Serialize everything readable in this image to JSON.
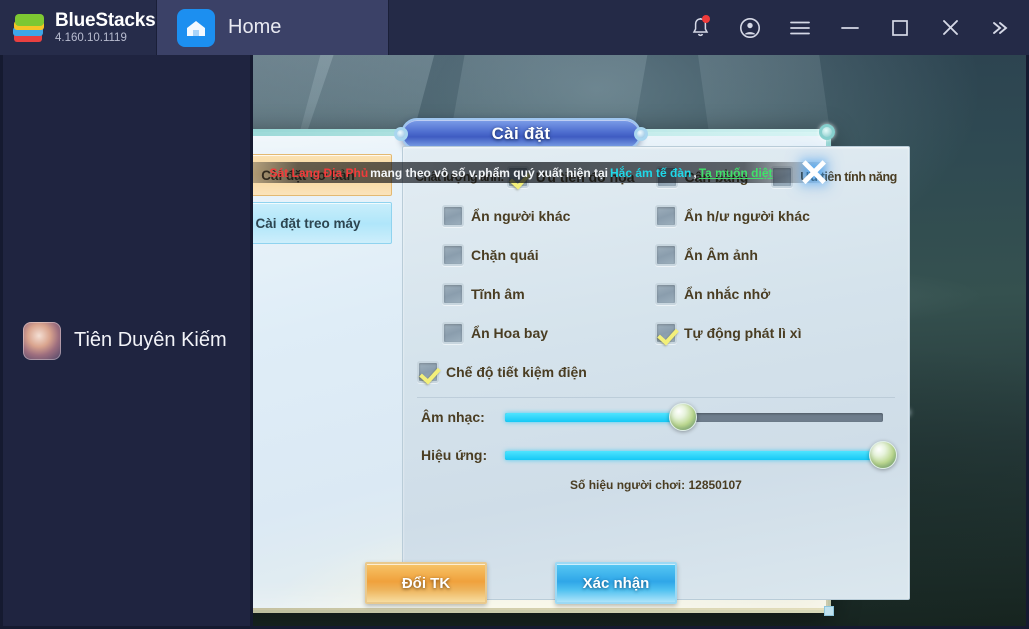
{
  "bluestacks": {
    "brand": "BlueStacks",
    "version": "4.160.10.1119",
    "tabs": [
      {
        "label": "Home",
        "icon": "home-icon"
      },
      {
        "label": "Tiên Duyên Kiếm",
        "icon": "game-avatar"
      }
    ],
    "controls": [
      {
        "name": "notifications-bell",
        "glyph": "🔔",
        "badge": true
      },
      {
        "name": "account",
        "glyph": "ⓘ"
      },
      {
        "name": "menu",
        "glyph": "☰"
      },
      {
        "name": "minimize",
        "glyph": "–"
      },
      {
        "name": "maximize",
        "glyph": "☐"
      },
      {
        "name": "close",
        "glyph": "✕"
      },
      {
        "name": "expand-more",
        "glyph": "»"
      }
    ]
  },
  "banner": {
    "highlight": "Sát Lang Địa Phủ",
    "text": "mang theo vô số v.phẩm quý xuất hiện tại",
    "place": "Hắc ám tế đàn",
    "comma": ",",
    "action": "Ta muốn diệt"
  },
  "dialog": {
    "title": "Cài đặt",
    "close_label": "✕",
    "side_tabs": [
      {
        "label": "Cài đặt cơ bản",
        "active": true
      },
      {
        "label": "Cài đặt treo máy",
        "active": false
      }
    ],
    "quality_label": "Chất lượng ảnh:",
    "quality_options": [
      {
        "label": "Ưu tiên đồ họa",
        "checked": true
      },
      {
        "label": "Cân bằng",
        "checked": false
      },
      {
        "label": "Ưu tiên tính năng",
        "checked": false
      }
    ],
    "option_rows": [
      {
        "left": {
          "label": "Ẩn người khác",
          "checked": false
        },
        "right": {
          "label": "Ẩn h/ư người khác",
          "checked": false
        }
      },
      {
        "left": {
          "label": "Chặn quái",
          "checked": false
        },
        "right": {
          "label": "Ẩn Âm ảnh",
          "checked": false
        }
      },
      {
        "left": {
          "label": "Tĩnh âm",
          "checked": false
        },
        "right": {
          "label": "Ẩn nhắc nhở",
          "checked": false
        }
      },
      {
        "left": {
          "label": "Ẩn Hoa bay",
          "checked": false
        },
        "right": {
          "label": "Tự động phát lì xì",
          "checked": true
        }
      }
    ],
    "power_save": {
      "label": "Chế độ tiết kiệm điện",
      "checked": true
    },
    "sliders": [
      {
        "label": "Âm nhạc:",
        "value": 47
      },
      {
        "label": "Hiệu ứng:",
        "value": 100
      }
    ],
    "player_id_text": "Số hiệu người chơi: 12850107",
    "buttons": [
      {
        "label": "Đổi TK",
        "style": "gold"
      },
      {
        "label": "Xác nhận",
        "style": "blue"
      }
    ]
  },
  "colors": {
    "bs_bar": "#242a47",
    "accent_blue": "#2fa6e8",
    "accent_gold": "#f0a13c",
    "banner_red": "#f33b3b",
    "banner_cyan": "#1fd8e8",
    "banner_green": "#41e06a",
    "check_yellow": "#f3f07a"
  }
}
